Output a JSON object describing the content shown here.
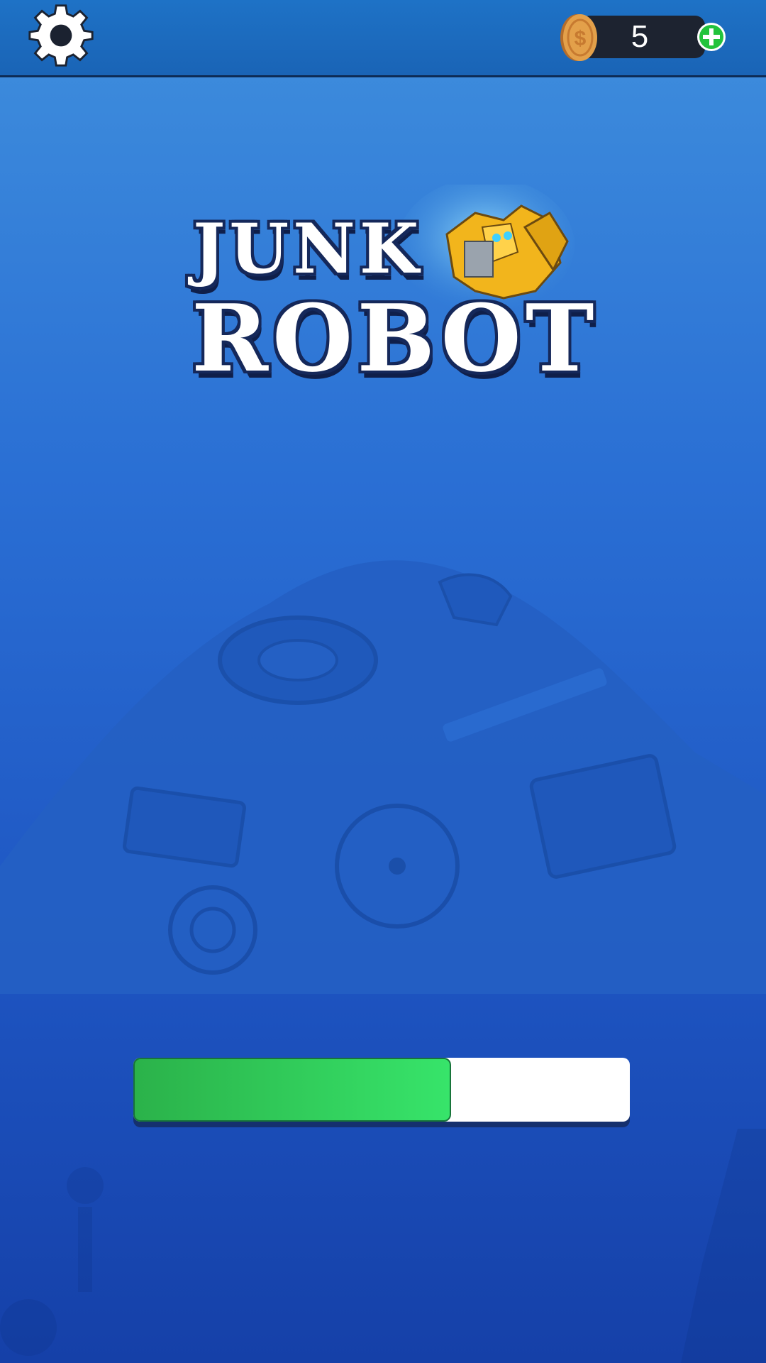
{
  "header": {
    "coin_count": "5"
  },
  "logo": {
    "line1": "JUNK",
    "line2": "ROBOT"
  },
  "loading": {
    "progress_fraction": 0.64
  },
  "icons": {
    "settings": "gear-icon",
    "coin": "coin-icon",
    "add_coins": "plus-icon"
  },
  "colors": {
    "progress_fill": "#37e46a",
    "add_button": "#22c33c",
    "coin": "#e3a04a"
  }
}
